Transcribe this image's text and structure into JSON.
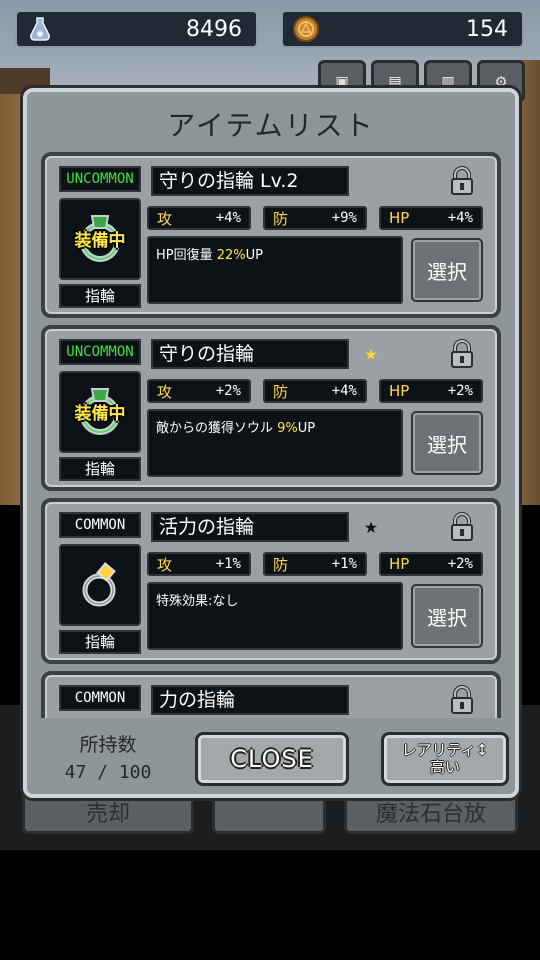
{
  "hud": {
    "souls": "8496",
    "coins": "154",
    "soul_icon": "soul-flask-icon",
    "coin_icon": "gold-coin-icon"
  },
  "background_buttons": {
    "sell": "売却",
    "magic_stone": "魔法石台放"
  },
  "panel": {
    "title": "アイテムリスト",
    "owned_label": "所持数",
    "owned_count": "47 / 100",
    "close_label": "CLOSE",
    "sort_line1": "レアリティ↕",
    "sort_line2": "高い"
  },
  "items": [
    {
      "rarity": "UNCOMMON",
      "name": "守りの指輪 Lv.2",
      "equipped": "装備中",
      "type": "指輪",
      "atk_label": "攻",
      "atk": "+4%",
      "def_label": "防",
      "def": "+9%",
      "hp_label": "HP",
      "hp": "+4%",
      "effect_text": "HP回復量 ",
      "effect_value": "22%",
      "effect_suffix": "UP",
      "select": "選択"
    },
    {
      "rarity": "UNCOMMON",
      "name": "守りの指輪",
      "equipped": "装備中",
      "type": "指輪",
      "atk_label": "攻",
      "atk": "+2%",
      "def_label": "防",
      "def": "+4%",
      "hp_label": "HP",
      "hp": "+2%",
      "effect_text": "敵からの獲得ソウル ",
      "effect_value": "9%",
      "effect_suffix": "UP",
      "select": "選択",
      "star": "★"
    },
    {
      "rarity": "COMMON",
      "name": "活力の指輪",
      "type": "指輪",
      "atk_label": "攻",
      "atk": "+1%",
      "def_label": "防",
      "def": "+1%",
      "hp_label": "HP",
      "hp": "+2%",
      "effect_text": "特殊効果:なし",
      "select": "選択",
      "star": "★"
    },
    {
      "rarity": "COMMON",
      "name": "力の指輪"
    }
  ],
  "colors": {
    "uncommon": "#3ee03e",
    "common": "#ffffff",
    "stat_label": "#ffd84a",
    "highlight": "#ffe94a",
    "star_gold": "#ffd23a",
    "star_dark": "#0d1216"
  }
}
